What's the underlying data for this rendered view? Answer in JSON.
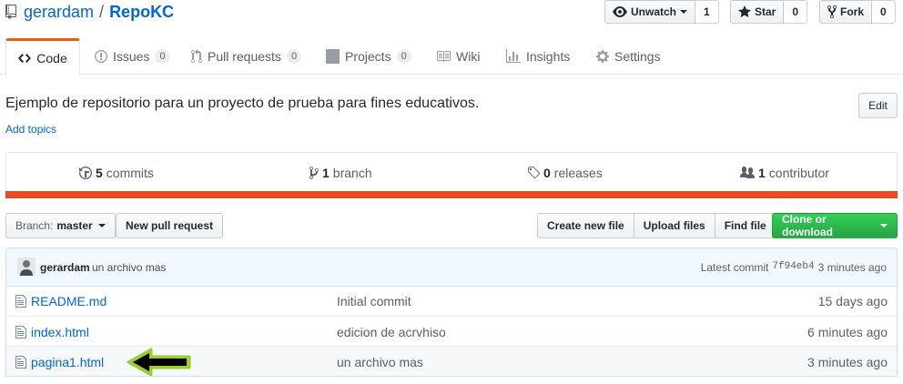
{
  "repo": {
    "owner": "gerardam",
    "separator": "/",
    "name": "RepoKC"
  },
  "social": {
    "watch_label": "Unwatch",
    "watch_count": "1",
    "star_label": "Star",
    "star_count": "0",
    "fork_label": "Fork",
    "fork_count": "0"
  },
  "tabs": [
    {
      "label": "Code",
      "icon": "code-icon",
      "selected": true
    },
    {
      "label": "Issues",
      "count": "0",
      "icon": "issue-icon"
    },
    {
      "label": "Pull requests",
      "count": "0",
      "icon": "pull-request-icon"
    },
    {
      "label": "Projects",
      "count": "0",
      "icon": "project-icon"
    },
    {
      "label": "Wiki",
      "icon": "book-icon"
    },
    {
      "label": "Insights",
      "icon": "graph-icon"
    },
    {
      "label": "Settings",
      "icon": "gear-icon"
    }
  ],
  "description": "Ejemplo de repositorio para un proyecto de prueba para fines educativos.",
  "add_topics": "Add topics",
  "edit_label": "Edit",
  "summary": {
    "commits_count": "5",
    "commits_label": "commits",
    "branch_count": "1",
    "branch_label": "branch",
    "releases_count": "0",
    "releases_label": "releases",
    "contributor_count": "1",
    "contributor_label": "contributor"
  },
  "language_bar_color": "#e34c26",
  "file_nav": {
    "branch_prefix": "Branch:",
    "branch_name": "master",
    "new_pr": "New pull request",
    "create_file": "Create new file",
    "upload_files": "Upload files",
    "find_file": "Find file",
    "clone": "Clone or download"
  },
  "commit_tease": {
    "author": "gerardam",
    "message": "un archivo mas",
    "latest_label": "Latest commit",
    "sha": "7f94eb4",
    "age": "3 minutes ago"
  },
  "files": [
    {
      "name": "README.md",
      "message": "Initial commit",
      "age": "15 days ago"
    },
    {
      "name": "index.html",
      "message": "edicion de acrvhiso",
      "age": "6 minutes ago"
    },
    {
      "name": "pagina1.html",
      "message": "un archivo mas",
      "age": "3 minutes ago"
    }
  ],
  "annotation_arrow": {
    "color": "#000000",
    "outline_color": "#9acd32"
  }
}
